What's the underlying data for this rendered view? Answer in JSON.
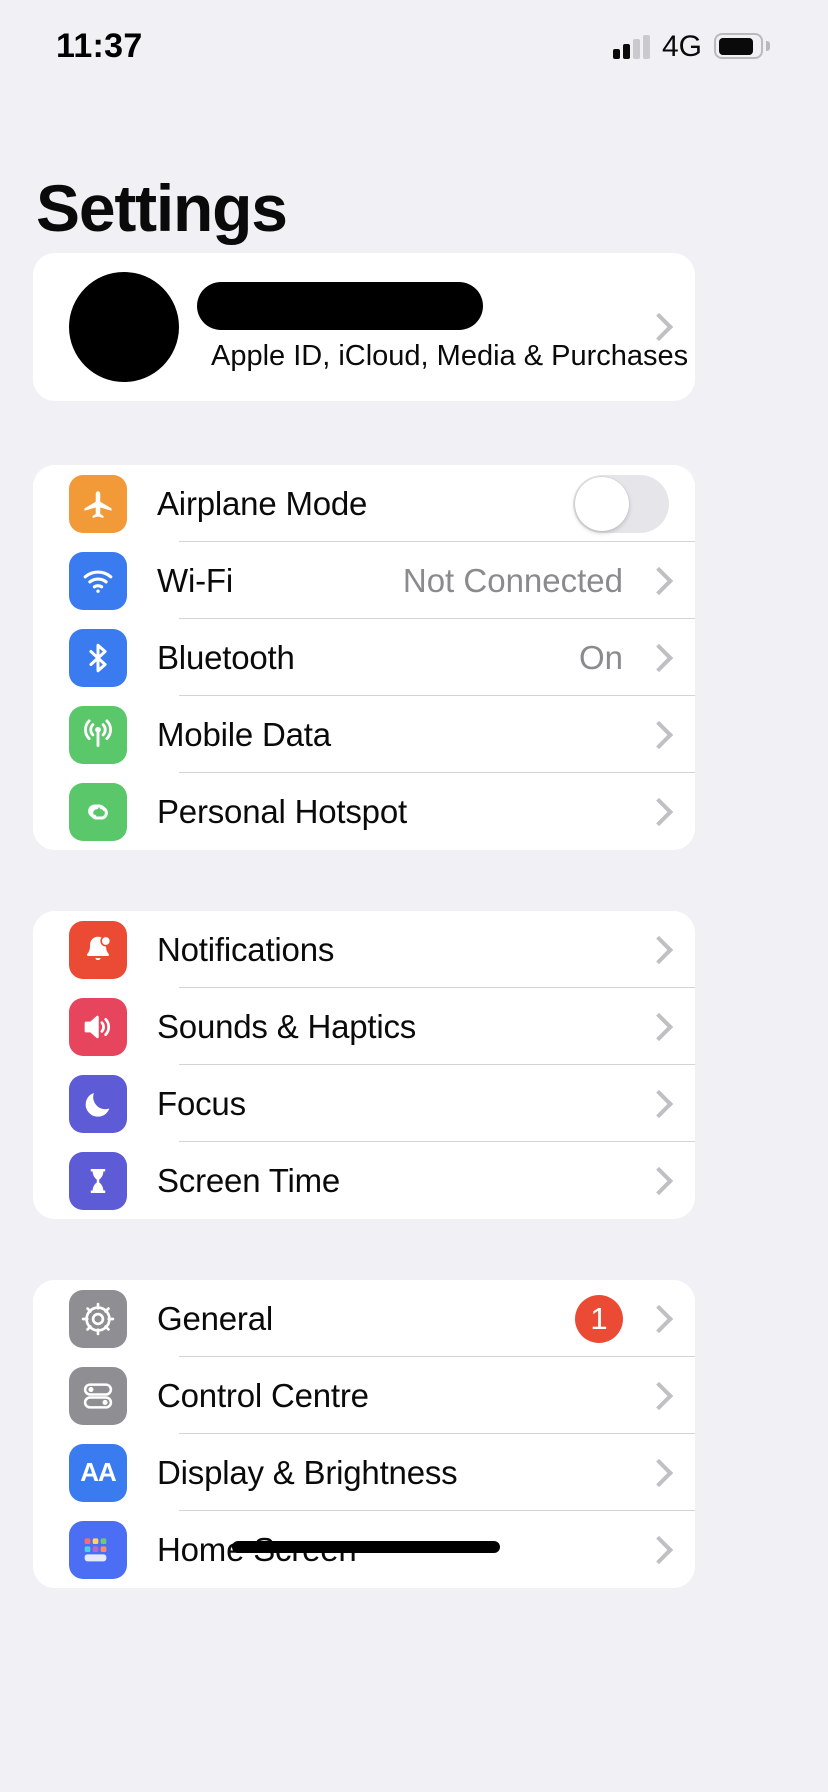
{
  "status_bar": {
    "time": "11:37",
    "network": "4G",
    "signal_bars_total": 4,
    "signal_bars_filled": 2,
    "battery_percent_visual": 86,
    "battery_icon": "battery-icon"
  },
  "header": {
    "title": "Settings"
  },
  "account": {
    "avatar_icon": "avatar",
    "name_redacted": true,
    "subtitle": "Apple ID, iCloud, Media & Purchases",
    "chevron_icon": "chevron-right-icon"
  },
  "groups": [
    {
      "id": "connectivity",
      "rows": [
        {
          "id": "airplane-mode",
          "label": "Airplane Mode",
          "icon": "airplane-icon",
          "icon_color": "#F29A38",
          "accessory": "toggle",
          "toggle_on": false
        },
        {
          "id": "wifi",
          "label": "Wi-Fi",
          "icon": "wifi-icon",
          "icon_color": "#3B7BF0",
          "accessory": "value-chevron",
          "value": "Not Connected"
        },
        {
          "id": "bluetooth",
          "label": "Bluetooth",
          "icon": "bluetooth-icon",
          "icon_color": "#3B7BF0",
          "accessory": "value-chevron",
          "value": "On"
        },
        {
          "id": "mobile-data",
          "label": "Mobile Data",
          "icon": "antenna-icon",
          "icon_color": "#5BC76B",
          "accessory": "chevron"
        },
        {
          "id": "personal-hotspot",
          "label": "Personal Hotspot",
          "icon": "hotspot-icon",
          "icon_color": "#5BC76B",
          "accessory": "chevron"
        }
      ]
    },
    {
      "id": "alerts",
      "rows": [
        {
          "id": "notifications",
          "label": "Notifications",
          "icon": "bell-icon",
          "icon_color": "#EB4B34",
          "accessory": "chevron"
        },
        {
          "id": "sounds-haptics",
          "label": "Sounds & Haptics",
          "icon": "speaker-icon",
          "icon_color": "#E7455D",
          "accessory": "chevron"
        },
        {
          "id": "focus",
          "label": "Focus",
          "icon": "moon-icon",
          "icon_color": "#5D5BD6",
          "accessory": "chevron"
        },
        {
          "id": "screen-time",
          "label": "Screen Time",
          "icon": "hourglass-icon",
          "icon_color": "#5D5BD6",
          "accessory": "chevron"
        }
      ]
    },
    {
      "id": "system",
      "rows": [
        {
          "id": "general",
          "label": "General",
          "icon": "gear-icon",
          "icon_color": "#8E8E93",
          "accessory": "badge-chevron",
          "badge": "1"
        },
        {
          "id": "control-centre",
          "label": "Control Centre",
          "icon": "sliders-icon",
          "icon_color": "#8E8E93",
          "accessory": "chevron"
        },
        {
          "id": "display-brightness",
          "label": "Display & Brightness",
          "icon": "text-size-icon",
          "icon_color": "#3B7BF0",
          "accessory": "chevron",
          "icon_text": "AA"
        },
        {
          "id": "home-screen",
          "label": "Home Screen",
          "icon": "app-grid-icon",
          "icon_color": "#4C6EF5",
          "accessory": "chevron"
        }
      ]
    }
  ],
  "colors": {
    "page_background": "#F1F1F5",
    "card_background": "#FFFFFF",
    "primary_text": "#0A0A0A",
    "secondary_text": "#8A8A8F",
    "separator": "#D3D3D8",
    "badge_red": "#EB4B34"
  }
}
